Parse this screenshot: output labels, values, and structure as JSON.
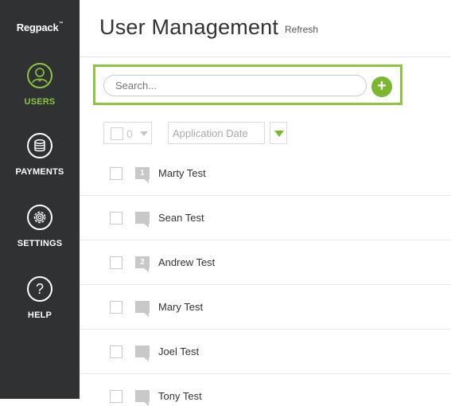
{
  "app": {
    "logo_text": "Regpack",
    "logo_tm": "™"
  },
  "sidebar": {
    "items": [
      {
        "label": "USERS",
        "icon": "user-icon",
        "active": true
      },
      {
        "label": "PAYMENTS",
        "icon": "coins-icon",
        "active": false
      },
      {
        "label": "SETTINGS",
        "icon": "gear-icon",
        "active": false
      },
      {
        "label": "HELP",
        "icon": "help-icon",
        "glyph": "?",
        "active": false
      }
    ],
    "colors": {
      "background": "#2f3133",
      "accent": "#8cc63f"
    }
  },
  "header": {
    "title": "User Management",
    "refresh_label": "Refresh"
  },
  "search": {
    "placeholder": "Search...",
    "value": "",
    "add_label": "+"
  },
  "toolbar": {
    "selected_count": "0",
    "sort_field": "Application Date"
  },
  "users": [
    {
      "name": "Marty Test",
      "badge": "1"
    },
    {
      "name": "Sean Test",
      "badge": ""
    },
    {
      "name": "Andrew Test",
      "badge": "2"
    },
    {
      "name": "Mary Test",
      "badge": ""
    },
    {
      "name": "Joel Test",
      "badge": ""
    },
    {
      "name": "Tony Test",
      "badge": ""
    }
  ],
  "colors": {
    "accent_green": "#8cc63f",
    "add_button_green": "#7cb82f"
  }
}
